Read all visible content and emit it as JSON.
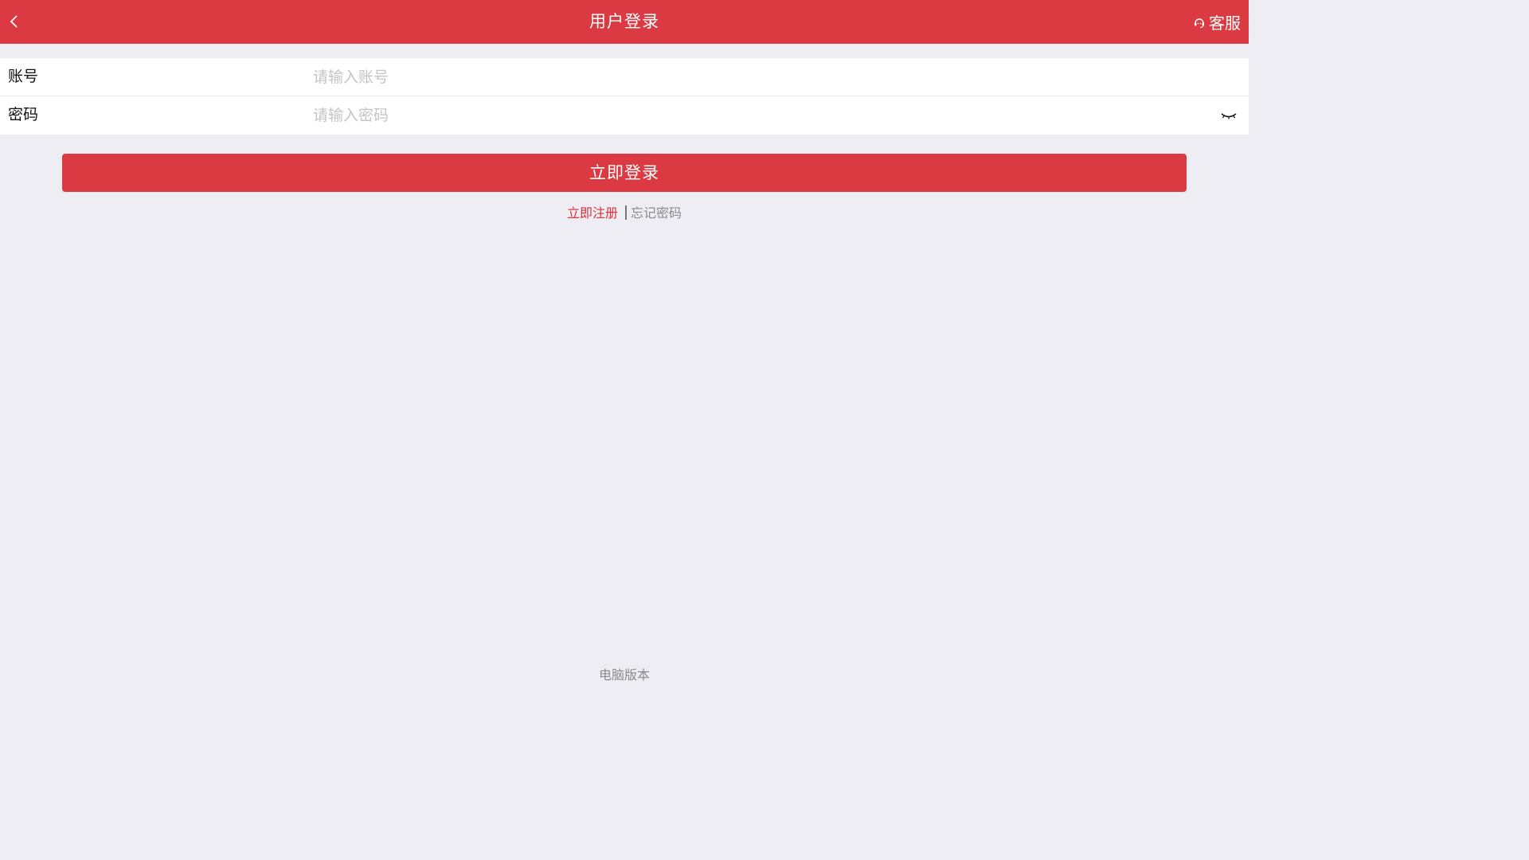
{
  "header": {
    "title": "用户登录",
    "back_icon": "chevron-left-icon",
    "service_icon": "headset-icon",
    "service_label": "客服"
  },
  "form": {
    "account": {
      "label": "账号",
      "placeholder": "请输入账号",
      "value": ""
    },
    "password": {
      "label": "密码",
      "placeholder": "请输入密码",
      "value": "",
      "toggle_icon": "eye-closed-icon"
    }
  },
  "login_button_label": "立即登录",
  "links": {
    "register": "立即注册",
    "forgot": "忘记密码"
  },
  "footer": {
    "desktop_version": "电脑版本"
  },
  "colors": {
    "brand_red": "#dc3a42",
    "background": "#efedf4"
  }
}
